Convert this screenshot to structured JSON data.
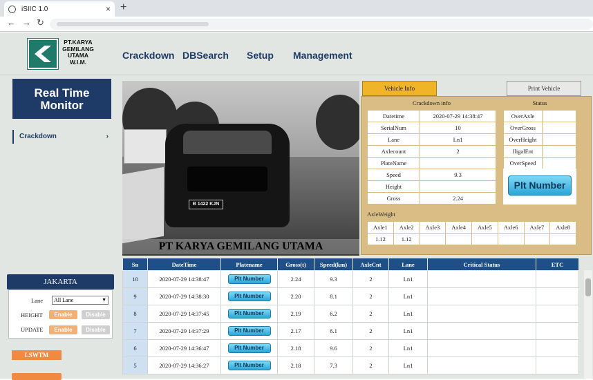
{
  "browser": {
    "tab_title": "iSIIC 1.0",
    "close_glyph": "×",
    "newtab_glyph": "+",
    "back_glyph": "←",
    "forward_glyph": "→",
    "reload_glyph": "↻"
  },
  "header": {
    "company_lines": [
      "PT.KARYA",
      "GEMILANG",
      "UTAMA",
      "W.I.M."
    ],
    "nav": [
      "Crackdown",
      "DBSearch",
      "Setup",
      "Management"
    ]
  },
  "sidebar": {
    "title_line1": "Real Time",
    "title_line2": "Monitor",
    "crackdown_label": "Crackdown",
    "crackdown_chevron": "›",
    "site_name": "JAKARTA",
    "lane_label": "Lane",
    "lane_value": "All Lane",
    "height_label": "HEIGHT",
    "update_label": "UPDATE",
    "enable_label": "Enable",
    "disable_label": "Disable",
    "lswtm_label": "LSWTM"
  },
  "camera": {
    "caption": "PT KARYA GEMILANG UTAMA",
    "plate_text": "B 1422 KJN"
  },
  "info": {
    "tab_vehicle": "Vehicle Info",
    "tab_print": "Print Vehicle",
    "crackdown_title": "Crackdown info",
    "status_title": "Status",
    "crackdown_rows": [
      {
        "k": "Datetime",
        "v": "2020-07-29 14:38:47"
      },
      {
        "k": "SerialNum",
        "v": "10"
      },
      {
        "k": "Lane",
        "v": "Ln1"
      },
      {
        "k": "Axlecount",
        "v": "2"
      },
      {
        "k": "PlateName",
        "v": ""
      },
      {
        "k": "Speed",
        "v": "9.3"
      },
      {
        "k": "Height",
        "v": ""
      },
      {
        "k": "Gross",
        "v": "2.24"
      }
    ],
    "status_rows": [
      {
        "k": "OverAxle",
        "v": ""
      },
      {
        "k": "OverGross",
        "v": ""
      },
      {
        "k": "OverHeight",
        "v": ""
      },
      {
        "k": "IligalEnt",
        "v": ""
      },
      {
        "k": "OverSpeed",
        "v": ""
      }
    ],
    "plt_button": "Plt Number",
    "axle_title": "AxleWeight",
    "axle_headers": [
      "Axle1",
      "Axle2",
      "Axle3",
      "Axle4",
      "Axle5",
      "Axle6",
      "Axle7",
      "Axle8"
    ],
    "axle_values": [
      "1.12",
      "1.12",
      "",
      "",
      "",
      "",
      "",
      ""
    ]
  },
  "table": {
    "headers": [
      "Sn",
      "DateTime",
      "Platename",
      "Gross(t)",
      "Speed(km)",
      "AxleCnt",
      "Lane",
      "Critical Status",
      "ETC"
    ],
    "plt_label": "Plt Number",
    "rows": [
      {
        "sn": "10",
        "dt": "2020-07-29 14:38:47",
        "gross": "2.24",
        "speed": "9.3",
        "axle": "2",
        "lane": "Ln1",
        "crit": "",
        "etc": ""
      },
      {
        "sn": "9",
        "dt": "2020-07-29 14:38:30",
        "gross": "2.20",
        "speed": "8.1",
        "axle": "2",
        "lane": "Ln1",
        "crit": "",
        "etc": ""
      },
      {
        "sn": "8",
        "dt": "2020-07-29 14:37:45",
        "gross": "2.19",
        "speed": "6.2",
        "axle": "2",
        "lane": "Ln1",
        "crit": "",
        "etc": ""
      },
      {
        "sn": "7",
        "dt": "2020-07-29 14:37:29",
        "gross": "2.17",
        "speed": "6.1",
        "axle": "2",
        "lane": "Ln1",
        "crit": "",
        "etc": ""
      },
      {
        "sn": "6",
        "dt": "2020-07-29 14:36:47",
        "gross": "2.18",
        "speed": "9.6",
        "axle": "2",
        "lane": "Ln1",
        "crit": "",
        "etc": ""
      },
      {
        "sn": "5",
        "dt": "2020-07-29 14:36:27",
        "gross": "2.18",
        "speed": "7.3",
        "axle": "2",
        "lane": "Ln1",
        "crit": "",
        "etc": ""
      }
    ]
  },
  "icons": {
    "favicon": "globe-icon",
    "lane_dropdown": "chevron-down-icon"
  }
}
